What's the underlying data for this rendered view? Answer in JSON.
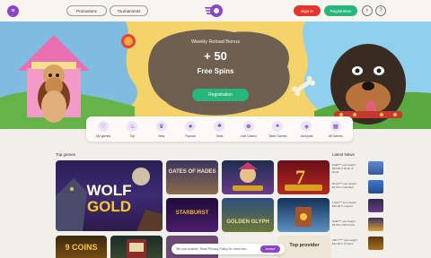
{
  "header": {
    "promotions_label": "Promotions",
    "tournaments_label": "Tournaments",
    "signin_label": "Sign in",
    "register_label": "Registration",
    "search_icon": "search-icon",
    "help_icon": "help-icon"
  },
  "banner": {
    "subtitle": "Weekly Reload Bonus",
    "amount": "+ 50",
    "free": "Free Spins",
    "cta": "Registration"
  },
  "categories": [
    {
      "label": "My games",
      "icon": "♡"
    },
    {
      "label": "Top",
      "icon": "♨"
    },
    {
      "label": "New",
      "icon": "♛"
    },
    {
      "label": "Popular",
      "icon": "★"
    },
    {
      "label": "Slots",
      "icon": "♣"
    },
    {
      "label": "Live Casino",
      "icon": "♚"
    },
    {
      "label": "Table Games",
      "icon": "♠"
    },
    {
      "label": "Jackpots",
      "icon": "◈"
    },
    {
      "label": "All Games",
      "icon": "▦"
    }
  ],
  "sections": {
    "top_games": "Top games",
    "latest_news": "Latest News",
    "top_provider": "Top provider"
  },
  "games": {
    "wolf_line1": "WOLF",
    "wolf_line2": "GOLD",
    "gates": "GATES OF HADES",
    "starburst": "STARBURST",
    "golden_glyph": "GOLDEN GLYPH",
    "coins": "9 COINS"
  },
  "cookie": {
    "text": "We use cookies. Read Privacy Policy for more info.",
    "button": "Accept"
  },
  "news": [
    {
      "line1": "Riddl*** just caught",
      "line2": "$25.60 in Book of",
      "line3": "Dead"
    },
    {
      "line1": "Brunh*** just caught",
      "line2": "$2.50 in Gold Bull",
      "line3": ""
    },
    {
      "line1": "Frank*** just caught",
      "line2": "$30.00 in Legacy",
      "line3": ""
    },
    {
      "line1": "Riddl*** just caught",
      "line2": "$4.00 in Wolf Gold",
      "line3": ""
    },
    {
      "line1": "CRC***** just caught",
      "line2": "$12.00 in 9 Coins",
      "line3": ""
    }
  ],
  "colors": {
    "accent": "#8d44c9",
    "signin": "#e3362f",
    "register": "#27b67b",
    "banner_bg": "#f4d46a"
  }
}
